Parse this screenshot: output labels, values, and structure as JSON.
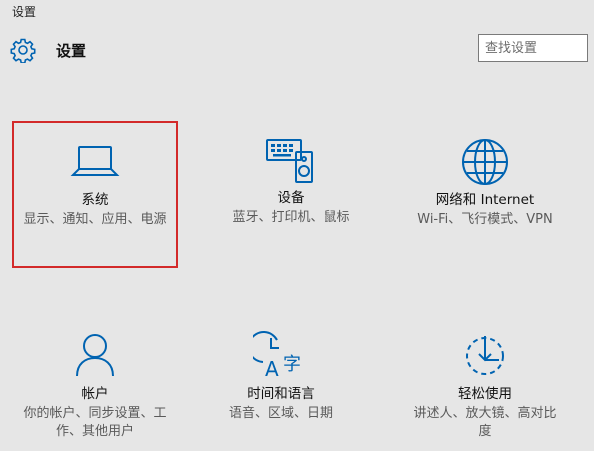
{
  "window": {
    "title": "设置"
  },
  "header": {
    "title": "设置"
  },
  "search": {
    "placeholder": "查找设置",
    "value": ""
  },
  "colors": {
    "accent": "#0063b1",
    "highlight_border": "#d32a2a",
    "background": "#e6e6e6"
  },
  "tiles": [
    {
      "name": "系统",
      "desc": "显示、通知、应用、电源",
      "icon": "laptop-icon",
      "selected": true
    },
    {
      "name": "设备",
      "desc": "蓝牙、打印机、鼠标",
      "icon": "devices-icon"
    },
    {
      "name": "网络和 Internet",
      "desc": "Wi-Fi、飞行模式、VPN",
      "icon": "globe-icon"
    },
    {
      "name": "帐户",
      "desc": "你的帐户、同步设置、工作、其他用户",
      "icon": "person-icon"
    },
    {
      "name": "时间和语言",
      "desc": "语音、区域、日期",
      "icon": "time-language-icon"
    },
    {
      "name": "轻松使用",
      "desc": "讲述人、放大镜、高对比度",
      "icon": "ease-of-access-icon"
    }
  ]
}
